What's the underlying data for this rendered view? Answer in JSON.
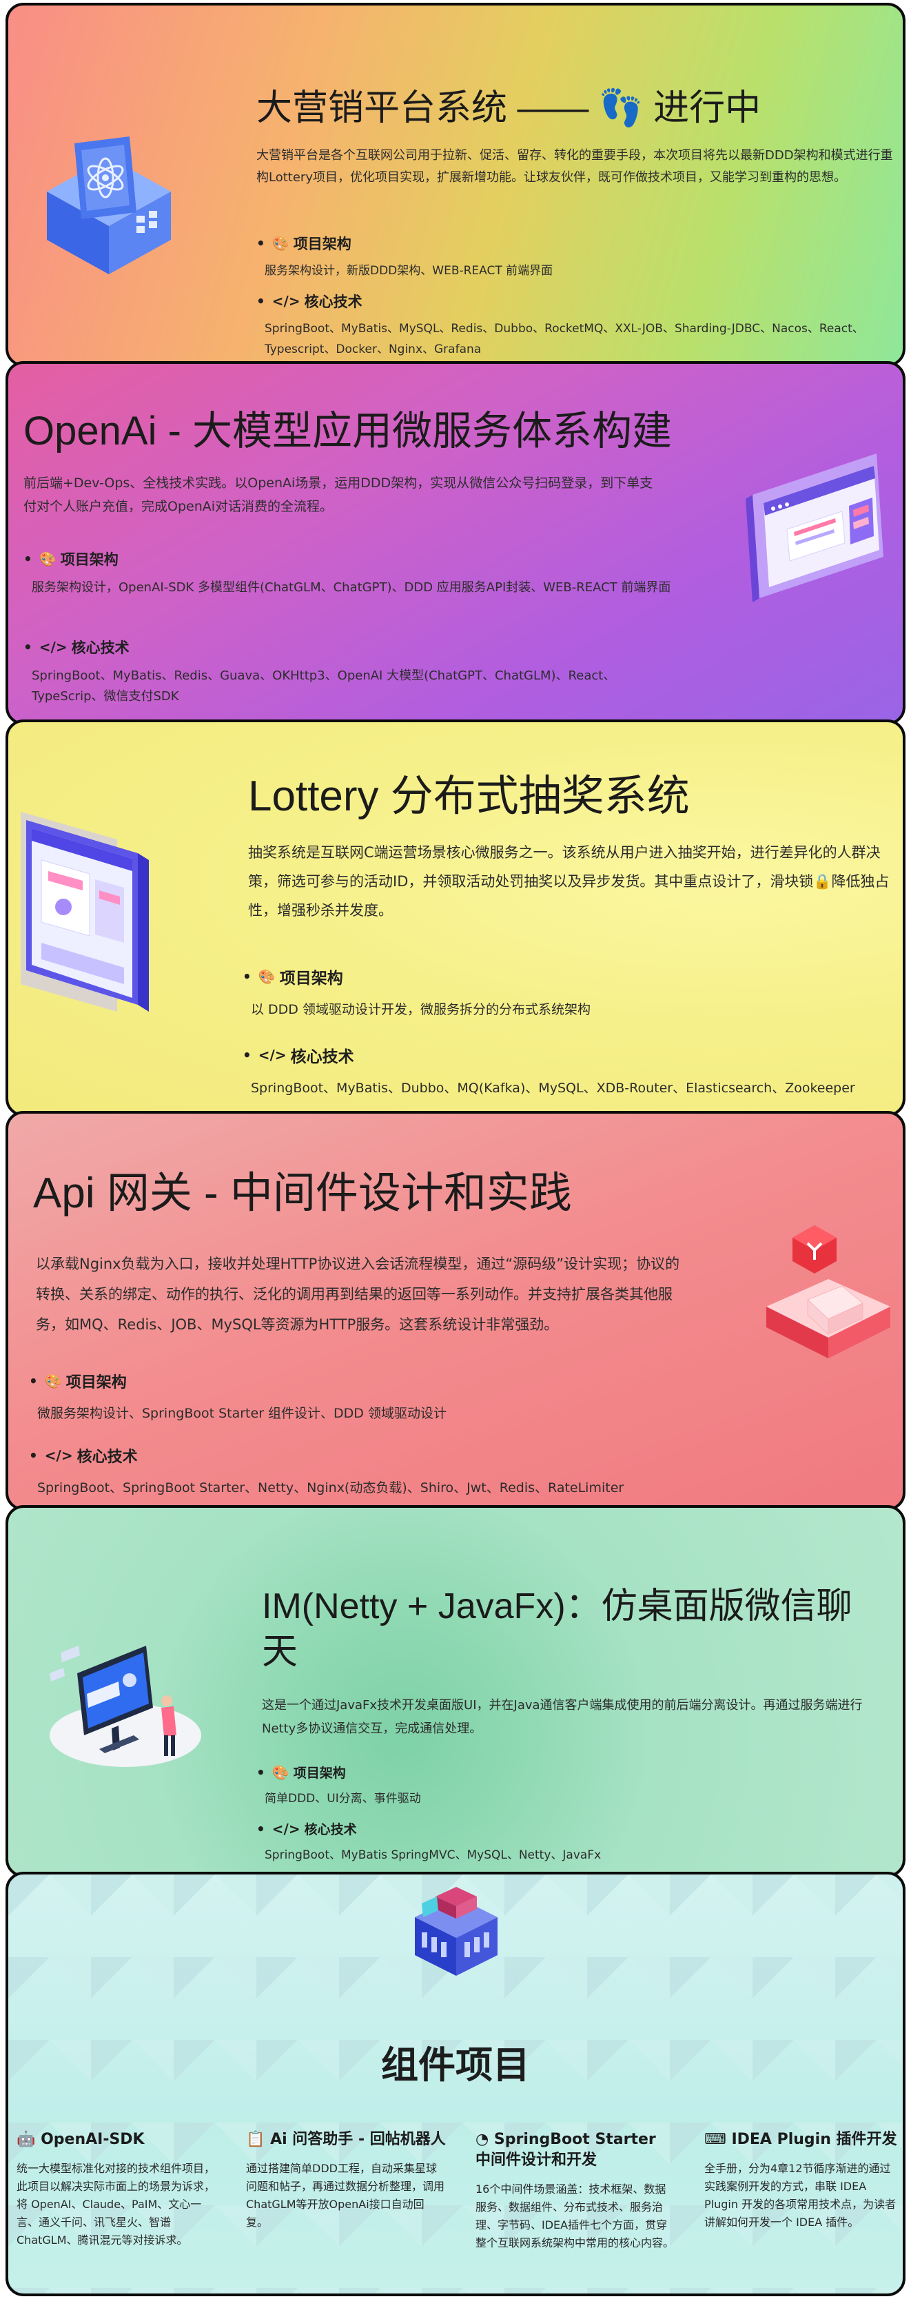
{
  "cards": [
    {
      "title": "大营销平台系统 —— 👣 进行中",
      "desc": "大营销平台是各个互联网公司用于拉新、促活、留存、转化的重要手段，本次项目将先以最新DDD架构和模式进行重构Lottery项目，优化项目实现，扩展新增功能。让球友伙伴，既可作做技术项目，又能学习到重构的思想。",
      "arch_label": "项目架构",
      "arch_text": "服务架构设计，新版DDD架构、WEB-REACT 前端界面",
      "tech_label": "核心技术",
      "tech_text": "SpringBoot、MyBatis、MySQL、Redis、Dubbo、RocketMQ、XXL-JOB、Sharding-JDBC、Nacos、React、Typescript、Docker、Nginx、Grafana"
    },
    {
      "title": "OpenAi - 大模型应用微服务体系构建",
      "desc": "前后端+Dev-Ops、全栈技术实践。以OpenAi场景，运用DDD架构，实现从微信公众号扫码登录，到下单支付对个人账户充值，完成OpenAi对话消费的全流程。",
      "arch_label": "项目架构",
      "arch_text": "服务架构设计，OpenAI-SDK 多模型组件(ChatGLM、ChatGPT)、DDD 应用服务API封装、WEB-REACT 前端界面",
      "tech_label": "核心技术",
      "tech_text": "SpringBoot、MyBatis、Redis、Guava、OKHttp3、OpenAI 大模型(ChatGPT、ChatGLM)、React、TypeScrip、微信支付SDK"
    },
    {
      "title": "Lottery 分布式抽奖系统",
      "desc": "抽奖系统是互联网C端运营场景核心微服务之一。该系统从用户进入抽奖开始，进行差异化的人群决策，筛选可参与的活动ID，并领取活动处罚抽奖以及异步发货。其中重点设计了，滑块锁🔒降低独占性，增强秒杀并发度。",
      "arch_label": "项目架构",
      "arch_text": "以 DDD 领域驱动设计开发，微服务拆分的分布式系统架构",
      "tech_label": "核心技术",
      "tech_text": "SpringBoot、MyBatis、Dubbo、MQ(Kafka)、MySQL、XDB-Router、Elasticsearch、Zookeeper"
    },
    {
      "title": "Api 网关 - 中间件设计和实践",
      "desc": "以承载Nginx负载为入口，接收并处理HTTP协议进入会话流程模型，通过“源码级”设计实现；协议的转换、关系的绑定、动作的执行、泛化的调用再到结果的返回等一系列动作。并支持扩展各类其他服务，如MQ、Redis、JOB、MySQL等资源为HTTP服务。这套系统设计非常强劲。",
      "arch_label": "项目架构",
      "arch_text": "微服务架构设计、SpringBoot Starter 组件设计、DDD 领域驱动设计",
      "tech_label": "核心技术",
      "tech_text": "SpringBoot、SpringBoot Starter、Netty、Nginx(动态负载)、Shiro、Jwt、Redis、RateLimiter"
    },
    {
      "title": "IM(Netty + JavaFx)：仿桌面版微信聊天",
      "desc": "这是一个通过JavaFx技术开发桌面版UI，并在Java通信客户端集成使用的前后端分离设计。再通过服务端进行Netty多协议通信交互，完成通信处理。",
      "arch_label": "项目架构",
      "arch_text": "简单DDD、UI分离、事件驱动",
      "tech_label": "核心技术",
      "tech_text": "SpringBoot、MyBatis SpringMVC、MySQL、Netty、JavaFx"
    }
  ],
  "components": {
    "title": "组件项目",
    "items": [
      {
        "icon": "robot-icon",
        "title": "OpenAI-SDK",
        "text": "统一大模型标准化对接的技术组件项目，此项目以解决实际市面上的场景为诉求，将 OpenAI、Claude、PaIM、文心一言、通义千问、讯飞星火、智谱ChatGLM、腾讯混元等对接诉求。"
      },
      {
        "icon": "clipboard-icon",
        "title": "Ai 问答助手 - 回帖机器人",
        "text": "通过搭建简单DDD工程，自动采集星球问题和帖子，再通过数据分析整理，调用ChatGLM等开放OpenAi接口自动回复。"
      },
      {
        "icon": "pie-chart-icon",
        "title": "SpringBoot Starter 中间件设计和开发",
        "text": "16个中间件场景涵盖：技术框架、数据服务、数据组件、分布式技术、服务治理、字节码、IDEA插件七个方面，贯穿整个互联网系统架构中常用的核心内容。"
      },
      {
        "icon": "terminal-icon",
        "title": "IDEA Plugin 插件开发",
        "text": "全手册，分为4章12节循序渐进的通过实践案例开发的方式，串联 IDEA Plugin 开发的各项常用技术点，为读者讲解如何开发一个 IDEA 插件。"
      }
    ]
  }
}
